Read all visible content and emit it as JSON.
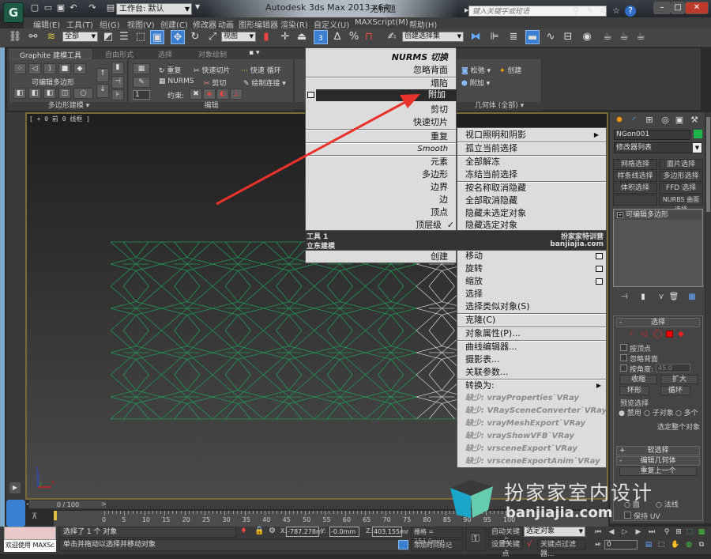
{
  "titlebar": {
    "app_title": "Autodesk 3ds Max  2013 x64",
    "doc_title": "无标题",
    "workspace": "工作台: 默认",
    "search_placeholder": "键入关键字或短语",
    "logo": "G"
  },
  "menubar": [
    "编辑(E)",
    "工具(T)",
    "组(G)",
    "视图(V)",
    "创建(C)",
    "修改器",
    "动画",
    "图形编辑器",
    "渲染(R)",
    "自定义(U)",
    "MAXScript(M)",
    "帮助(H)"
  ],
  "main_toolbar": {
    "selection_filter": "全部",
    "ref_coord": "视图",
    "named_selection": "创建选择集",
    "snap_label": "3"
  },
  "ribbon": {
    "tabs": [
      "Graphite 建模工具",
      "自由形式",
      "选择",
      "对象绘制"
    ],
    "panel1_label": "可编辑多边形",
    "panel1_footer": "多边形建模",
    "edit_items": {
      "repeat": "重复",
      "quickslice": "快速切片",
      "quickloop": "快速 循环",
      "nurms": "NURMS",
      "cut": "剪切",
      "paintconnect": "绘制连接",
      "constraint": "约束:"
    },
    "edit_footer": "编辑",
    "spinner_value": "1",
    "geom_items": {
      "relax": "松弛",
      "create": "创建",
      "attach": "附加"
    },
    "geom_footer": "几何体 (全部)"
  },
  "viewport": {
    "label": "[ + 0 前 0 线框 ]",
    "axis": {
      "x": "x",
      "y": "y",
      "z": "z"
    }
  },
  "quad_menu": {
    "top_left": [
      "NURMS 切换",
      "忽略背面",
      "塌陷",
      "附加",
      "剪切",
      "快速切片"
    ],
    "highlighted": "附加",
    "mid_left": [
      "重复",
      "Smooth",
      "元素",
      "多边形",
      "边界",
      "边",
      "顶点",
      "顶层级"
    ],
    "checked": "顶层级",
    "check_mark": "✓",
    "title1_left": "工具 1",
    "title1_right": "扮家家特训营",
    "title2_left": "立东建模",
    "title2_right": "banjiajia.com",
    "bottom_left": [
      "创建"
    ],
    "top_right": [
      "视口照明和阴影",
      "孤立当前选择",
      "全部解冻",
      "冻结当前选择",
      "按名称取消隐藏",
      "全部取消隐藏",
      "隐藏未选定对象",
      "隐藏选定对象"
    ],
    "bottom_right": [
      "移动",
      "旋转",
      "缩放",
      "选择",
      "选择类似对象(S)",
      "克隆(C)",
      "对象属性(P)...",
      "曲线编辑器...",
      "摄影表...",
      "关联参数...",
      "转换为:"
    ],
    "missing": [
      "缺少: vrayProperties`VRay",
      "缺少: VRaySceneConverter`VRay",
      "缺少: vrayMeshExport`VRay",
      "缺少: vrayShowVFB`VRay",
      "缺少: vrsceneExport`VRay",
      "缺少: vrsceneExportAnim`VRay"
    ]
  },
  "command_panel": {
    "object_name": "NGon001",
    "object_color": "#1fb54c",
    "modifier_list": "修改器列表",
    "mod_buttons": [
      "网格选择",
      "面片选择",
      "样条线选择",
      "多边形选择",
      "体积选择",
      "FFD 选择",
      "",
      "NURBS 曲面选择"
    ],
    "stack_item": "可编辑多边形",
    "selection_rollout": "选择",
    "by_vertex": "按顶点",
    "ignore_backface": "忽略背面",
    "by_angle": "按角度:",
    "angle_value": "45.0",
    "shrink": "收缩",
    "grow": "扩大",
    "ring": "环形",
    "loop": "循环",
    "preview_label": "预览选择",
    "preview_opts": [
      "禁用",
      "子对象",
      "多个"
    ],
    "whole_object": "选定整个对象",
    "soft_selection": "软选择",
    "edit_geometry": "编辑几何体",
    "repeat_last": "重复上一个",
    "constraint_opts": [
      "面",
      "法线"
    ],
    "preserve_uv": "保持 UV"
  },
  "timeline": {
    "slider": "0 / 100",
    "ticks": [
      0,
      5,
      10,
      15,
      20,
      25,
      30,
      35,
      40,
      45,
      50,
      55,
      60,
      65,
      70,
      75,
      80,
      85,
      90,
      95,
      100
    ]
  },
  "status": {
    "welcome": "欢迎使用 MAXSc",
    "selected": "选择了 1 个 对象",
    "prompt": "单击并拖动以选择并移动对象",
    "x": "-787.278m",
    "y": "-0.0mm",
    "z": "403.155mr",
    "grid": "栅格 = 254.0mm",
    "add_tag": "添加时间标记",
    "auto_key": "自动关键点",
    "set_key": "设置关键点",
    "selected_obj": "选定对象",
    "key_filters": "关键点过滤器...",
    "frame": "0"
  },
  "watermark": {
    "text": "扮家家室内设计",
    "url": "banjiajia.com"
  }
}
